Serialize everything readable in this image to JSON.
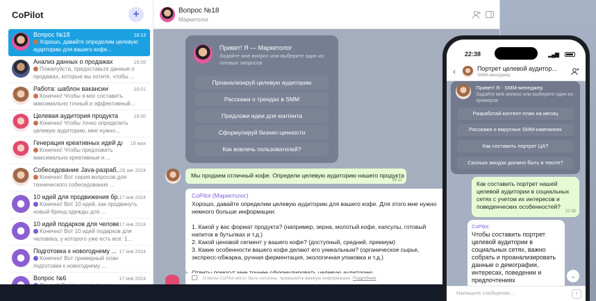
{
  "sidebar": {
    "title": "CoPilot",
    "new_chat": "+",
    "chats": [
      {
        "name": "Вопрос №18",
        "time": "16:13",
        "preview": "Хорошо, давайте определим целевую аудиторию для вашего кофе...",
        "avatar": "av-marketer",
        "active": true
      },
      {
        "name": "Анализ данных о продажах",
        "time": "16:05",
        "preview": "Пожалуйста, предоставьте данные о продажах, которые вы хотите, чтобы ...",
        "avatar": "av-dark"
      },
      {
        "name": "Работа: шаблон вакансии",
        "time": "16:01",
        "preview": "Конечно! Чтобы я мог составить максимально точный и эффективный...",
        "avatar": "av-lady"
      },
      {
        "name": "Целевая аудитория продукта",
        "time": "16:00",
        "preview": "Конечно! Чтобы точно определить целевую аудиторию, мне нужно...",
        "avatar": "av-clown"
      },
      {
        "name": "Генерация креативных идей для ...",
        "time": "19 мая",
        "preview": "Конечно! Чтобы предложить максимально креативные и ...",
        "avatar": "av-clown"
      },
      {
        "name": "Собеседование Java-разраб...",
        "time": "26 авг 2024",
        "preview": "Конечно! Вот серия вопросов для технического собеседования ...",
        "avatar": "av-lady"
      },
      {
        "name": "10 идей для продвижения бр...",
        "time": "17 янв 2024",
        "preview": "Конечно! Вот 10 идей, как продвинуть новый бренд одежды для ...",
        "avatar": "av-purple"
      },
      {
        "name": "10 идей подарков для челове...",
        "time": "17 янв 2024",
        "preview": "Конечно! Вот 10 идей подарков для человека, у которого уже есть все: 1...",
        "avatar": "av-purple"
      },
      {
        "name": "Подготовка к новогоднему ...",
        "time": "17 янв 2024",
        "preview": "Конечно! Вот примерный план подготовки к новогоднему ...",
        "avatar": "av-purple"
      },
      {
        "name": "Вопрос №6",
        "time": "17 янв 2024",
        "preview": "Привет! Всегда готов помочь...",
        "avatar": "av-purple"
      }
    ]
  },
  "chat": {
    "title": "Вопрос №18",
    "subtitle": "Маркетолог",
    "welcome": {
      "title": "Привет! Я — Маркетолог",
      "subtitle": "Задайте мне вопрос или выберите один из готовых запросов",
      "suggestions": [
        "Проанализируй целевую аудиторию",
        "Расскажи о трендах в SMM",
        "Предложи идеи для контента",
        "Сформулируй бизнес-ценности",
        "Как вовлечь пользователей?"
      ]
    },
    "user_message": "Мы продаем отличный кофе. Определи целевую аудиторию нашего продукта",
    "user_time": "16:11",
    "bot_sender": "CoPilot (Маркетолог)",
    "bot_message": "Хорошо, давайте определим целевую аудиторию для вашего кофе. Для этого мне нужно немного больше информации:\n\n1. Какой у вас формат продукта? (например, зерна, молотый кофе, капсулы, готовый напиток в бутылках и т.д.)\n2. Какой ценовой сегмент у вашего кофе? (доступный, средний, премиум)\n3. Какие особенности вашего кофе делают его уникальным? (органическое сырье, экспресс-обжарка, ручная ферментация, экологичная упаковка и т.д.)\n\nОтветы помогут мне точнее сформулировать целевую аудиторию.",
    "disclaimer": "Ответы CoPilot могут быть неточны, проверяйте важную информацию.",
    "disclaimer_link": "Подробнее"
  },
  "phone": {
    "time": "22:38",
    "signal": "▂▄▆",
    "chat_title": "Портрет целевой аудитор...",
    "chat_subtitle": "SMM-менеджер",
    "back": "‹",
    "welcome_title": "Привет! Я - SMM-менеджер",
    "welcome_subtitle": "Задайте мне вопрос или выберите один из примеров",
    "suggestions": [
      "Разработай контент-план на месяц",
      "Расскажи о вирусных SMM-кампаниях",
      "Как составить портрет ЦА?",
      "Сколько эмодзи должно быть в тексте?"
    ],
    "user_message": "Как составить портрет нашей целевой аудитории в социальных сетях с учетом их интересов и поведенческих особенностей?",
    "user_time": "22:38",
    "bot_sender": "CoPilot",
    "bot_message": "Чтобы составить портрет целевой аудитории в социальных сетях, важно собрать и проанализировать данные о демографии, интересах, поведении и предпочтениях потенциальных клиентов.",
    "input_placeholder": "Напишите сообщение...",
    "scroll_down": "⌄",
    "send": "↑"
  }
}
